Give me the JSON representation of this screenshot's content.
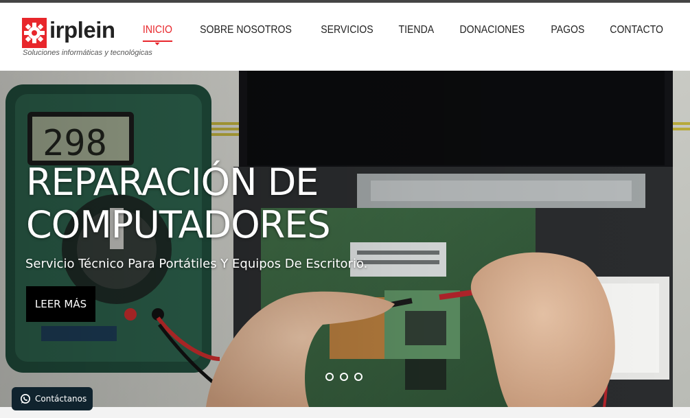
{
  "brand": {
    "name": "irplein",
    "tagline": "Soluciones informáticas y tecnológicas",
    "accent_color": "#e8262b",
    "logo_icon": "gear-icon"
  },
  "nav": {
    "items": [
      {
        "label": "INICIO",
        "active": true
      },
      {
        "label": "SOBRE NOSOTROS",
        "active": false
      },
      {
        "label": "SERVICIOS",
        "active": false
      },
      {
        "label": "TIENDA",
        "active": false
      },
      {
        "label": "DONACIONES",
        "active": false
      },
      {
        "label": "PAGOS",
        "active": false
      },
      {
        "label": "CONTACTO",
        "active": false
      }
    ]
  },
  "hero": {
    "title_line1": "REPARACIÓN DE",
    "title_line2": "COMPUTADORES",
    "subtitle": "Servicio Técnico Para Portátiles Y Equipos De Escritorio.",
    "button_label": "LEER MÁS",
    "multimeter_reading": "298",
    "slides_count": 3,
    "active_slide": 1
  },
  "whatsapp": {
    "label": "Contáctanos",
    "icon": "whatsapp-icon",
    "color": "#10232e"
  }
}
